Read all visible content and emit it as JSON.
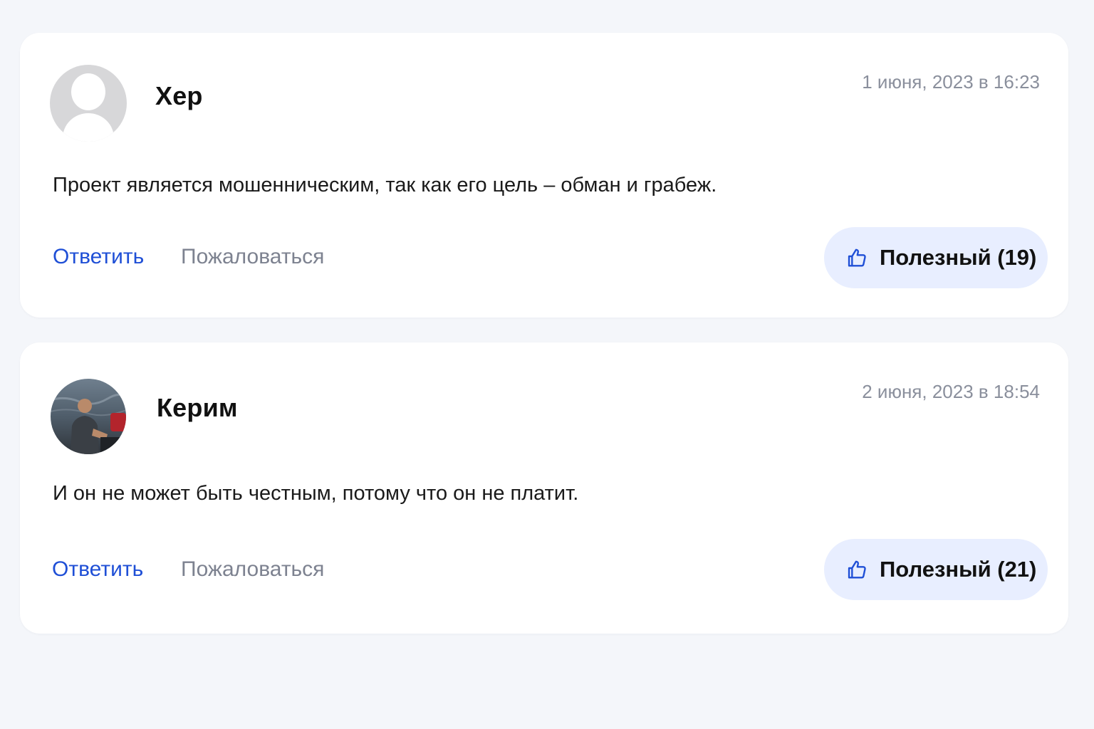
{
  "colors": {
    "page_background": "#f4f6fa",
    "card_background": "#ffffff",
    "reply_link": "#1f4fd6",
    "report_link": "#7d8290",
    "date_text": "#8a8f9c",
    "helpful_button_bg": "#e8eeff",
    "helpful_icon": "#1f4fd6"
  },
  "comments": [
    {
      "author": "Хер",
      "avatar": "default-avatar-placeholder",
      "date": "1 июня, 2023 в 16:23",
      "text": "Проект является мошенническим, так как его цель – обман и грабеж.",
      "reply_label": "Ответить",
      "report_label": "Пожаловаться",
      "helpful_label": "Полезный (19)",
      "helpful_icon": "thumbs-up-icon"
    },
    {
      "author": "Керим",
      "avatar": "user-photo",
      "date": "2 июня, 2023 в 18:54",
      "text": "И он не может быть честным, потому что он не платит.",
      "reply_label": "Ответить",
      "report_label": "Пожаловаться",
      "helpful_label": "Полезный (21)",
      "helpful_icon": "thumbs-up-icon"
    }
  ]
}
